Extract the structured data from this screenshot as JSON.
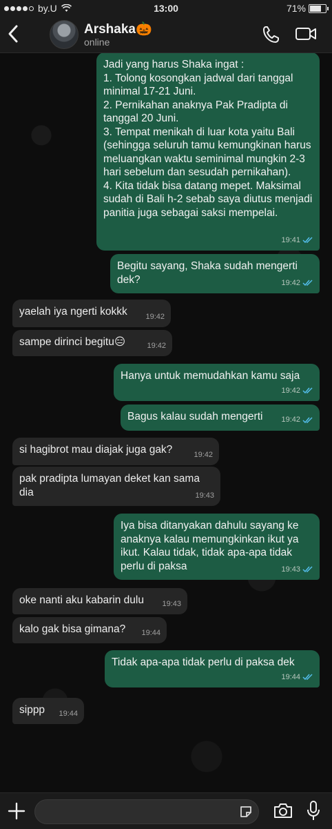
{
  "status": {
    "carrier": "by.U",
    "time": "13:00",
    "battery": "71%",
    "battery_level": 0.71
  },
  "header": {
    "contact_name": "Arshaka🎃",
    "presence": "online"
  },
  "messages": [
    {
      "dir": "out",
      "text": "Jadi yang harus Shaka ingat :\n1. Tolong kosongkan jadwal dari tanggal minimal 17-21 Juni.\n2. Pernikahan anaknya Pak Pradipta di tanggal 20 Juni.\n3. Tempat menikah di luar kota yaitu Bali (sehingga seluruh tamu kemungkinan harus meluangkan waktu seminimal mungkin 2-3 hari sebelum dan sesudah pernikahan).\n4. Kita tidak bisa datang mepet. Maksimal sudah di Bali h-2 sebab saya diutus menjadi panitia juga sebagai saksi mempelai.",
      "time": "19:41"
    },
    {
      "dir": "out",
      "text": "Begitu sayang, Shaka sudah mengerti dek?",
      "time": "19:42"
    },
    {
      "dir": "in",
      "text": "yaelah iya ngerti kokkk",
      "time": "19:42"
    },
    {
      "dir": "in",
      "text": "sampe dirinci begitu😑",
      "time": "19:42"
    },
    {
      "dir": "out",
      "text": "Hanya untuk memudahkan kamu saja",
      "time": "19:42"
    },
    {
      "dir": "out",
      "text": "Bagus kalau sudah mengerti",
      "time": "19:42"
    },
    {
      "dir": "in",
      "text": "si hagibrot mau diajak juga gak?",
      "time": "19:42"
    },
    {
      "dir": "in",
      "text": "pak pradipta lumayan deket kan sama dia",
      "time": "19:43"
    },
    {
      "dir": "out",
      "text": "Iya bisa ditanyakan dahulu sayang ke anaknya kalau memungkinkan ikut ya ikut. Kalau tidak, tidak apa-apa tidak perlu di paksa",
      "time": "19:43"
    },
    {
      "dir": "in",
      "text": "oke nanti aku kabarin dulu",
      "time": "19:43"
    },
    {
      "dir": "in",
      "text": "kalo gak bisa gimana?",
      "time": "19:44"
    },
    {
      "dir": "out",
      "text": "Tidak apa-apa tidak perlu di paksa dek",
      "time": "19:44"
    },
    {
      "dir": "in",
      "text": "sippp",
      "time": "19:44"
    }
  ],
  "icons": {
    "back": "chevron-left-icon",
    "voice_call": "phone-icon",
    "video_call": "video-camera-icon",
    "attach": "plus-icon",
    "sticker": "sticker-icon",
    "camera": "camera-icon",
    "microphone": "microphone-icon",
    "read_receipt": "double-check-icon"
  },
  "colors": {
    "outgoing_bubble": "#1d5c44",
    "incoming_bubble": "#262626",
    "read_ticks": "#53bdeb"
  }
}
